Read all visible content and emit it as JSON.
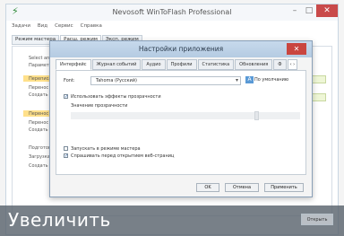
{
  "app": {
    "title": "Nevosoft WinToFlash Professional",
    "menu": [
      "Задачи",
      "Вид",
      "Сервис",
      "Справка"
    ],
    "tabs": [
      "Режим мастера",
      "Расш. режим",
      "Эксп. режим"
    ],
    "body_items": [
      "Select an...",
      "Параметры...",
      "Переписать...",
      "Перенос ф...",
      "Создать о...",
      "Перенос ф...",
      "Перенос ф...",
      "Создать о...",
      "Подготов...",
      "Загрузка и...",
      "Создать ф..."
    ]
  },
  "dialog": {
    "title": "Настройки приложения",
    "close_label": "✕",
    "tabs": [
      "Интерфейс",
      "Журнал событий",
      "Аудио",
      "Профили",
      "Статистика",
      "Обновления",
      "Ф"
    ],
    "tab_nav": "‹ ›",
    "font_label": "Font:",
    "font_value": "Tahoma (Русский)",
    "font_default": "По умолчанию",
    "transparency_checkbox": "Использовать эффекты прозрачности",
    "transparency_level": "Значение прозрачности",
    "master_checkbox": "Запускать в режиме мастера",
    "web_checkbox": "Спрашивать перед открытием веб-страниц",
    "ok_label": "OK",
    "cancel_label": "Отмена",
    "apply_label": "Применить"
  },
  "overlay": {
    "label": "Увеличить",
    "button_label": "Открыть"
  }
}
